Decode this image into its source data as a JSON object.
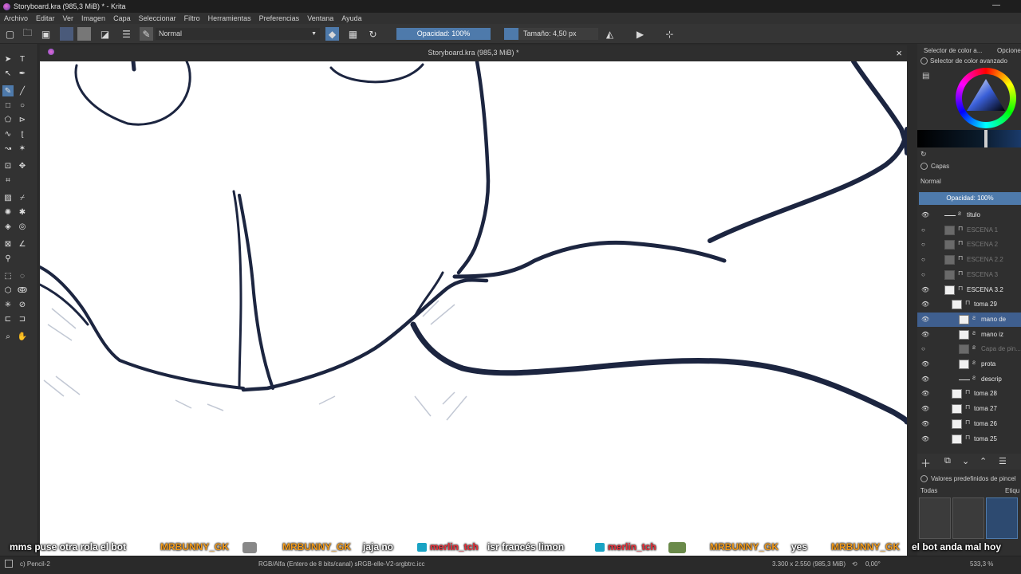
{
  "window": {
    "title": "Storyboard.kra (985,3 MiB) * - Krita",
    "minimize": "—"
  },
  "menu": [
    "Archivo",
    "Editar",
    "Ver",
    "Imagen",
    "Capa",
    "Seleccionar",
    "Filtro",
    "Herramientas",
    "Preferencias",
    "Ventana",
    "Ayuda"
  ],
  "toolbar": {
    "blend_mode": "Normal",
    "opacity_label": "Opacidad: 100%",
    "size_label": "Tamaño: 4,50 px"
  },
  "document": {
    "tab_title": "Storyboard.kra (985,3 MiB) *",
    "close": "×"
  },
  "dockers": {
    "color_tab1": "Selector de color a...",
    "color_tab2": "Opcione",
    "color_title": "Selector de color avanzado",
    "layers_title": "Capas",
    "layers_blend": "Normal",
    "layers_opacity": "Opacidad:  100%",
    "presets_title": "Valores predefinidos de pincel",
    "presets_filter": "Todas",
    "presets_tag": "Etiqu"
  },
  "layers": [
    {
      "name": "titulo",
      "visible": true,
      "dim": false,
      "indent": 0,
      "type": "line"
    },
    {
      "name": "ESCENA 1",
      "visible": false,
      "dim": true,
      "indent": 0,
      "type": "group"
    },
    {
      "name": "ESCENA 2",
      "visible": false,
      "dim": true,
      "indent": 0,
      "type": "group"
    },
    {
      "name": "ESCENA 2.2",
      "visible": false,
      "dim": true,
      "indent": 0,
      "type": "group"
    },
    {
      "name": "ESCENA 3",
      "visible": false,
      "dim": true,
      "indent": 0,
      "type": "group"
    },
    {
      "name": "ESCENA 3.2",
      "visible": true,
      "dim": false,
      "indent": 0,
      "type": "group"
    },
    {
      "name": "toma 29",
      "visible": true,
      "dim": false,
      "indent": 1,
      "type": "group"
    },
    {
      "name": "mano de",
      "visible": true,
      "dim": false,
      "indent": 2,
      "type": "paint",
      "selected": true
    },
    {
      "name": "mano iz",
      "visible": true,
      "dim": false,
      "indent": 2,
      "type": "paint"
    },
    {
      "name": "Capa de pin...",
      "visible": false,
      "dim": true,
      "indent": 2,
      "type": "paint"
    },
    {
      "name": "prota",
      "visible": true,
      "dim": false,
      "indent": 2,
      "type": "paint"
    },
    {
      "name": "descrip",
      "visible": true,
      "dim": false,
      "indent": 2,
      "type": "line"
    },
    {
      "name": "toma 28",
      "visible": true,
      "dim": false,
      "indent": 1,
      "type": "group"
    },
    {
      "name": "toma 27",
      "visible": true,
      "dim": false,
      "indent": 1,
      "type": "group"
    },
    {
      "name": "toma 26",
      "visible": true,
      "dim": false,
      "indent": 1,
      "type": "group"
    },
    {
      "name": "toma 25",
      "visible": true,
      "dim": false,
      "indent": 1,
      "type": "group"
    }
  ],
  "chat": [
    {
      "user": "",
      "msg": "mms puse otra rola el bot"
    },
    {
      "user": "MRBUNNY_GK",
      "msg": ""
    },
    {
      "user": "MRBUNNY_GK",
      "msg": "jaja no"
    },
    {
      "user": "merlin_tch",
      "msg": "isr francés limon"
    },
    {
      "user": "merlin_tch",
      "msg": ""
    },
    {
      "user": "MRBUNNY_GK",
      "msg": "yes"
    },
    {
      "user": "MRBUNNY_GK",
      "msg": "el bot anda mal hoy"
    }
  ],
  "status": {
    "brush": "c) Pencil-2",
    "colorspace": "RGB/Alfa (Entero de 8 bits/canal)  sRGB-elle-V2-srgbtrc.icc",
    "dimensions": "3.300 x 2.550 (985,3 MiB)",
    "rotation": "0,00°",
    "zoom": "533,3 %"
  },
  "colors": {
    "accent": "#4e7aab",
    "selected_layer": "#3f5f8f",
    "chat_user": "#f29a1a",
    "chat_user_alt": "#e8303a"
  }
}
